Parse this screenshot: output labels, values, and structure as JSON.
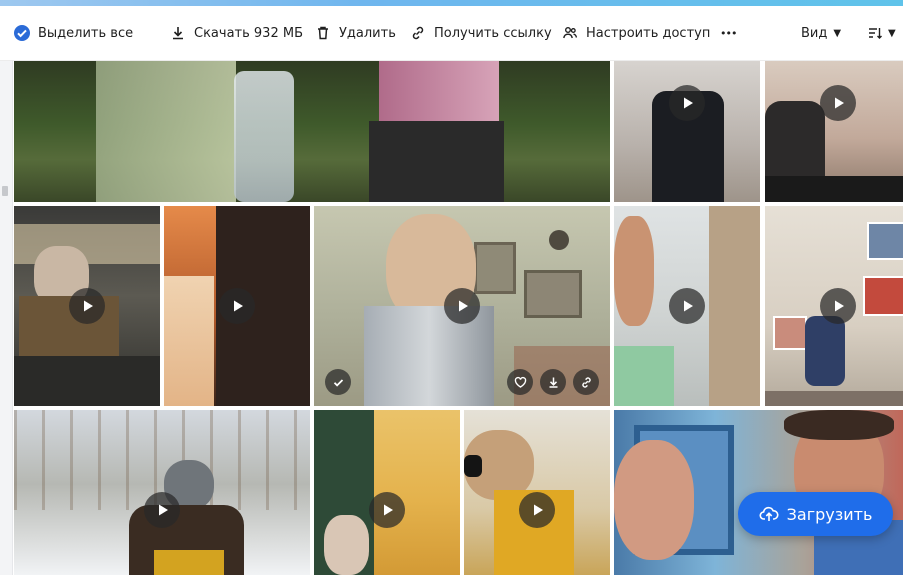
{
  "toolbar": {
    "select_all": "Выделить все",
    "download": "Скачать 932 МБ",
    "delete": "Удалить",
    "get_link": "Получить ссылку",
    "access": "Настроить доступ",
    "more": "•••",
    "view": "Вид"
  },
  "upload_label": "Загрузить",
  "colors": {
    "accent": "#1f6dea",
    "check": "#2b6bd7",
    "overlay": "#282828"
  },
  "tiles_count": 14
}
